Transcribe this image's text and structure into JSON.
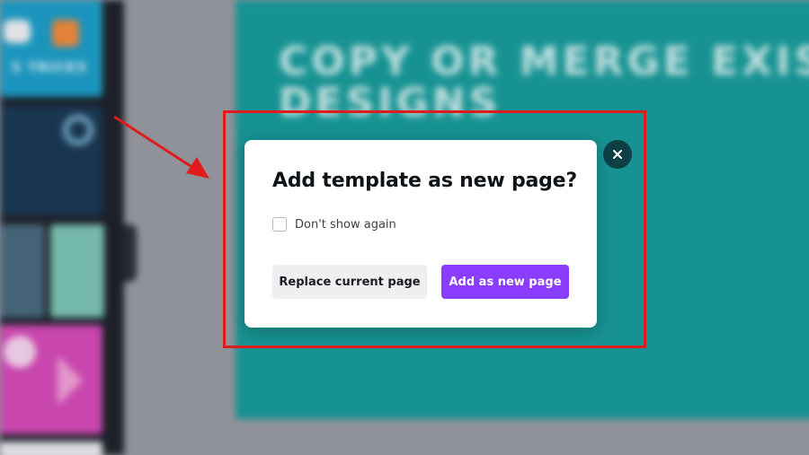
{
  "background": {
    "sidebar_thumb_text": "S TRICKS",
    "canvas_heading": "COPY OR MERGE EXIS\nDESIGNS"
  },
  "dialog": {
    "title": "Add template as new page?",
    "checkbox_label": "Don't show again",
    "checkbox_checked": false,
    "replace_button_label": "Replace current page",
    "add_button_label": "Add as new page",
    "close_icon": "close-icon"
  },
  "colors": {
    "primary_button": "#8b3dff",
    "secondary_button": "#efeff1",
    "canvas_teal": "#199c9c",
    "close_button": "#0d3f45",
    "annotation_red": "#e01b1b"
  }
}
